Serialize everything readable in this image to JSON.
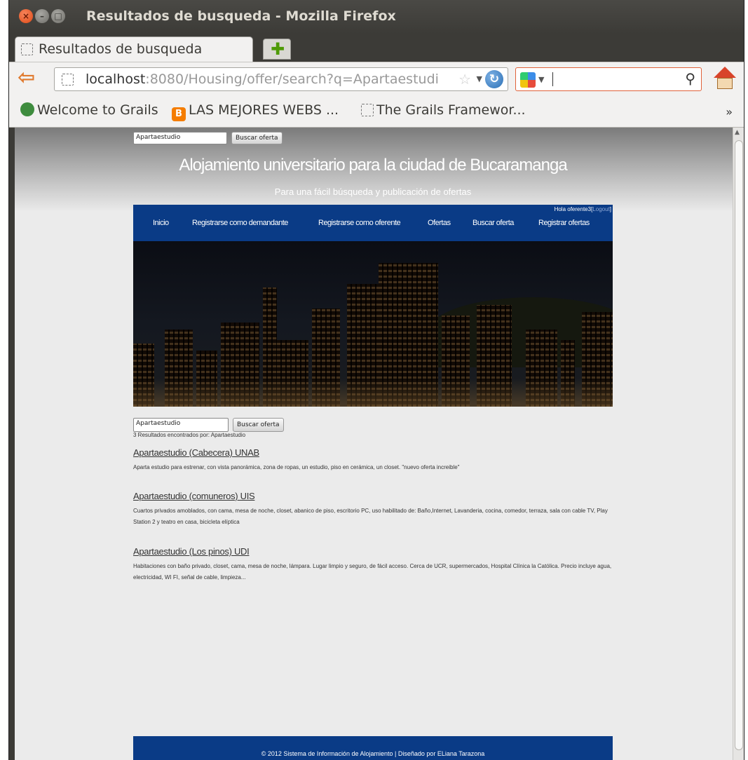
{
  "window": {
    "title": "Resultados de busqueda - Mozilla Firefox"
  },
  "tab": {
    "label": "Resultados de busqueda"
  },
  "navbar": {
    "url_host": "localhost",
    "url_rest": ":8080/Housing/offer/search?q=Apartaestudi",
    "search_value": ""
  },
  "bookmarks": [
    {
      "label": "Welcome to Grails",
      "icon": "grails-icon"
    },
    {
      "label": "LAS MEJORES WEBS ...",
      "icon": "blogger-icon"
    },
    {
      "label": "The Grails Framewor...",
      "icon": "page-icon"
    }
  ],
  "page": {
    "top_search": {
      "value": "Apartaestudio",
      "button": "Buscar oferta"
    },
    "site_title": "Alojamiento universitario para la ciudad de Bucaramanga",
    "site_subtitle": "Para una fácil búsqueda y publicación de ofertas",
    "greeting": "Hola oferente3",
    "greeting_link": "Logout",
    "menu": [
      "Inicio",
      "Registrarse como demandante",
      "Registrarse como oferente",
      "Ofertas",
      "Buscar oferta",
      "Registrar ofertas"
    ],
    "mid_search": {
      "value": "Apartaestudio",
      "button": "Buscar oferta"
    },
    "results_count": "3 Resultados encontrados por: Apartaestudio",
    "results": [
      {
        "title": "Apartaestudio (Cabecera) UNAB",
        "description": "Aparta estudio para estrenar, con vista panorámica, zona de ropas, un estudio, piso en cerámica, un closet. \"nuevo oferta increible\""
      },
      {
        "title": "Apartaestudio (comuneros) UIS",
        "description": "Cuartos privados amoblados, con cama, mesa de noche, closet, abanico de piso, escritorio PC, uso habilitado de: Baño,Internet, Lavanderia, cocina, comedor, terraza, sala con cable TV, Play Station 2 y teatro en casa, bicicleta elíptica"
      },
      {
        "title": "Apartaestudio (Los pinos) UDI",
        "description": "Habitaciones con baño privado, closet, cama, mesa de noche, lámpara. Lugar limpio y seguro, de fácil acceso. Cerca de UCR, supermercados, Hospital Clínica la Católica. Precio incluye agua, electricidad, WI FI, señal de cable, limpieza..."
      }
    ],
    "footer": "© 2012 Sistema de Información de Alojamiento | Diseñado por ELiana Tarazona"
  },
  "colors": {
    "menu_bg": "#0a3b86",
    "close_button": "#df4a16"
  }
}
